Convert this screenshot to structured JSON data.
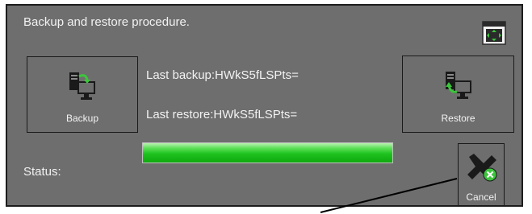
{
  "dialog": {
    "title": "Backup and restore procedure."
  },
  "icons": {
    "fullscreen": "fullscreen-arrows-icon",
    "backup": "computer-backup-icon",
    "restore": "computer-restore-icon",
    "cancel": "cancel-x-icon"
  },
  "buttons": {
    "backup_label": "Backup",
    "restore_label": "Restore",
    "cancel_label": "Cancel"
  },
  "info": {
    "last_backup": "Last backup:HWkS5fLSPts=",
    "last_restore": "Last restore:HWkS5fLSPts="
  },
  "status": {
    "label": "Status:",
    "progress_percent": 100
  },
  "colors": {
    "panel": "#6f6e6e",
    "accent_green": "#1ec21e",
    "icon_green": "#3cc63c",
    "icon_dark": "#1a1a1a"
  }
}
